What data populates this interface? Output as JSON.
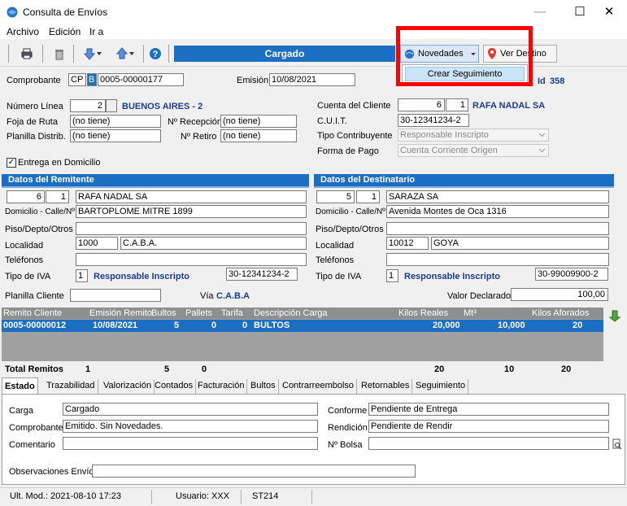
{
  "window": {
    "title": "Consulta de Envíos",
    "minimize": "—",
    "maximize": "☐",
    "close": "✕"
  },
  "menu": [
    "Archivo",
    "Edición",
    "Ir a"
  ],
  "toolbar": {
    "status": "Cargado",
    "novedades": "Novedades",
    "ver_destino": "Ver Destino",
    "dropdown_item": "Crear Seguimiento"
  },
  "header": {
    "comprobante_label": "Comprobante",
    "comprobante_type": "CP",
    "comprobante_letter": "B",
    "comprobante_number": "0005-00000177",
    "emision_label": "Emisión",
    "emision": "10/08/2021",
    "id_label": "Id",
    "id": "358"
  },
  "left": {
    "numero_linea_label": "Número Línea",
    "numero_linea": "2",
    "numero_linea_name": "BUENOS AIRES - 2",
    "foja_label": "Foja de Ruta",
    "foja": "(no tiene)",
    "recepcion_label": "Nº Recepción",
    "recepcion": "(no tiene)",
    "planilla_label": "Planilla Distrib.",
    "planilla": "(no tiene)",
    "retiro_label": "Nº Retiro",
    "retiro": "(no tiene)",
    "entrega_label": "Entrega en Domicilio"
  },
  "right": {
    "cuenta_label": "Cuenta del Cliente",
    "cuenta_num": "6",
    "cuenta_sub": "1",
    "cuenta_name": "RAFA NADAL SA",
    "cuit_label": "C.U.I.T.",
    "cuit": "30-12341234-2",
    "tipo_label": "Tipo Contribuyente",
    "tipo": "Responsable Inscripto",
    "forma_label": "Forma de Pago",
    "forma": "Cuenta Corriente Origen"
  },
  "remitente": {
    "title": "Datos del Remitente",
    "num": "6",
    "sub": "1",
    "name": "RAFA NADAL SA",
    "domicilio_label": "Domicilio - Calle/Nº",
    "domicilio": "BARTOPLOME MITRE 1899",
    "piso_label": "Piso/Depto/Otros",
    "localidad_label": "Localidad",
    "cp": "1000",
    "localidad": "C.A.B.A.",
    "telefonos_label": "Teléfonos",
    "iva_label": "Tipo de IVA",
    "iva_code": "1",
    "iva": "Responsable Inscripto",
    "cuit": "30-12341234-2"
  },
  "destinatario": {
    "title": "Datos del Destinatario",
    "num": "5",
    "sub": "1",
    "name": "SARAZA SA",
    "domicilio_label": "Domicilio - Calle/Nº",
    "domicilio": "Avenida Montes de Oca 1316",
    "piso_label": "Piso/Depto/Otros",
    "localidad_label": "Localidad",
    "cp": "10012",
    "localidad": "GOYA",
    "telefonos_label": "Teléfonos",
    "iva_label": "Tipo de IVA",
    "iva_code": "1",
    "iva": "Responsable Inscripto",
    "cuit": "30-99009900-2"
  },
  "misc": {
    "planilla_cliente_label": "Planilla Cliente",
    "via_label": "Vía",
    "via": "C.A.B.A",
    "valor_label": "Valor Declarado",
    "valor": "100,00"
  },
  "grid": {
    "columns": [
      "Remito Cliente",
      "Emisión Remito",
      "Bultos",
      "Pallets",
      "Tarifa",
      "Descripción Carga",
      "Kilos Reales",
      "Mt³",
      "Kilos Aforados"
    ],
    "row": [
      "0005-00000012",
      "10/08/2021",
      "5",
      "0",
      "0",
      "BULTOS",
      "20,000",
      "10,000",
      "20"
    ]
  },
  "totals": {
    "label": "Total Remitos",
    "remitos": "1",
    "bultos": "5",
    "pallets": "0",
    "kilos": "20",
    "mt3": "10",
    "aforados": "20"
  },
  "tabs": [
    "Estado",
    "Trazabilidad",
    "Valorización",
    "Contados",
    "Facturación",
    "Bultos",
    "Contrarreembolso",
    "Retornables",
    "Seguimiento"
  ],
  "estado": {
    "carga_label": "Carga",
    "carga": "Cargado",
    "comprobante_label": "Comprobante",
    "comprobante": "Emitido. Sin Novedades.",
    "comentario_label": "Comentario",
    "conforme_label": "Conforme",
    "conforme": "Pendiente de Entrega",
    "rendicion_label": "Rendición",
    "rendicion": "Pendiente de Rendir",
    "bolsa_label": "Nº Bolsa",
    "obs_label": "Observaciones Envío"
  },
  "statusbar": {
    "mod": "Ult. Mod.: 2021-08-10 17:23",
    "user": "Usuario: XXX",
    "st": "ST214"
  },
  "colors": {
    "accent": "#1b6ec2",
    "highlight": "#ff0000"
  }
}
